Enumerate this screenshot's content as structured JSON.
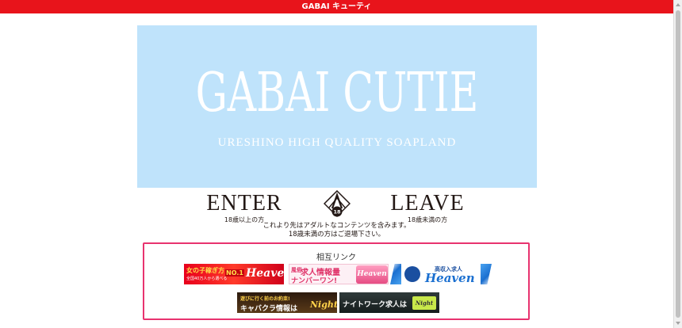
{
  "header": {
    "title": "GABAI キューティ"
  },
  "hero": {
    "title": "GABAI CUTIE",
    "subtitle": "URESHINO HIGH QUALITY SOAPLAND",
    "background": "#bfe3fb"
  },
  "enter": {
    "label": "ENTER",
    "caption": "18歳以上の方"
  },
  "leave": {
    "label": "LEAVE",
    "caption": "18歳未満の方"
  },
  "emblem": {
    "icon": "age-18-restriction-icon",
    "text": "18"
  },
  "notice": {
    "line1": "これより先はアダルトなコンテンツを含みます。",
    "line2": "18歳未満の方はご退場下さい。"
  },
  "links": {
    "title": "相互リンク",
    "border_color": "#e8336f",
    "banners": [
      {
        "line1": "女の子稼ぎ方",
        "line2": "全国40万人から選べる",
        "badge": "NO.1",
        "logo": "Heaven"
      },
      {
        "tag": "風俗",
        "line1": "求人情報量",
        "line2": "ナンバーワン!",
        "logo": "Heaven"
      },
      {
        "line1": "高収入求人",
        "logo": "Heaven"
      },
      {
        "line1": "遊びに行く前のお約束!",
        "line2": "キャバクラ情報は",
        "logo": "Night"
      },
      {
        "line1": "ナイトワーク求人は",
        "logo": "Night"
      }
    ]
  },
  "colors": {
    "topbar": "#e8141b",
    "text": "#231815"
  }
}
